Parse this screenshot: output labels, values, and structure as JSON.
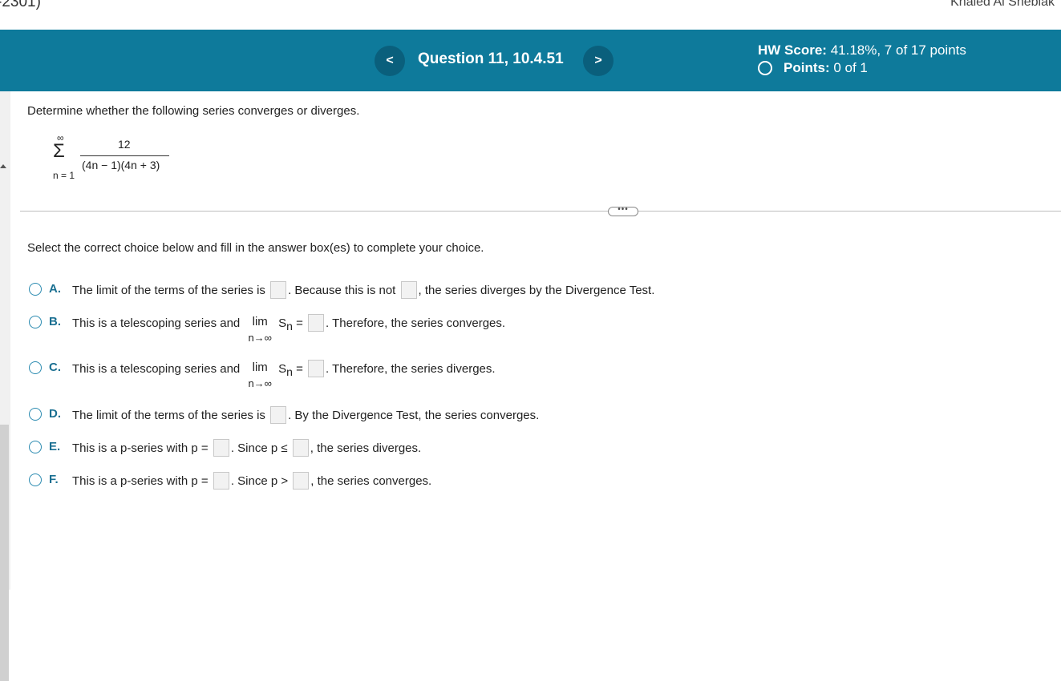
{
  "top_bar": {
    "left_text": "-2301)",
    "right_text": "Khaled Al Sheblak"
  },
  "header": {
    "prev_label": "<",
    "next_label": ">",
    "question_title": "Question 11, 10.4.51",
    "hw_score_label": "HW Score:",
    "hw_score_value": "41.18%, 7 of 17 points",
    "points_label": "Points:",
    "points_value": "0 of 1"
  },
  "question": {
    "prompt": "Determine whether the following series converges or diverges.",
    "series": {
      "upper": "∞",
      "sigma": "Σ",
      "lower": "n = 1",
      "numerator": "12",
      "denominator": "(4n − 1)(4n + 3)"
    },
    "more_label": "•••",
    "instruction": "Select the correct choice below and fill in the answer box(es) to complete your choice."
  },
  "choices": {
    "a": {
      "letter": "A.",
      "t1": "The limit of the terms of the series is",
      "t2": ". Because this is not",
      "t3": ", the series diverges by the Divergence Test."
    },
    "b": {
      "letter": "B.",
      "t1": "This is a telescoping series and",
      "lim": "lim",
      "lim_sub": "n→∞",
      "s": "S",
      "sub": "n",
      "eq": "=",
      "t2": ". Therefore, the series converges."
    },
    "c": {
      "letter": "C.",
      "t1": "This is a telescoping series and",
      "lim": "lim",
      "lim_sub": "n→∞",
      "s": "S",
      "sub": "n",
      "eq": "=",
      "t2": ". Therefore, the series diverges."
    },
    "d": {
      "letter": "D.",
      "t1": "The limit of the terms of the series is",
      "t2": ". By the Divergence Test, the series converges."
    },
    "e": {
      "letter": "E.",
      "t1": "This is a p-series with p =",
      "t2": ". Since p ≤",
      "t3": ", the series diverges."
    },
    "f": {
      "letter": "F.",
      "t1": "This is a p-series with p =",
      "t2": ". Since p >",
      "t3": ", the series converges."
    }
  }
}
